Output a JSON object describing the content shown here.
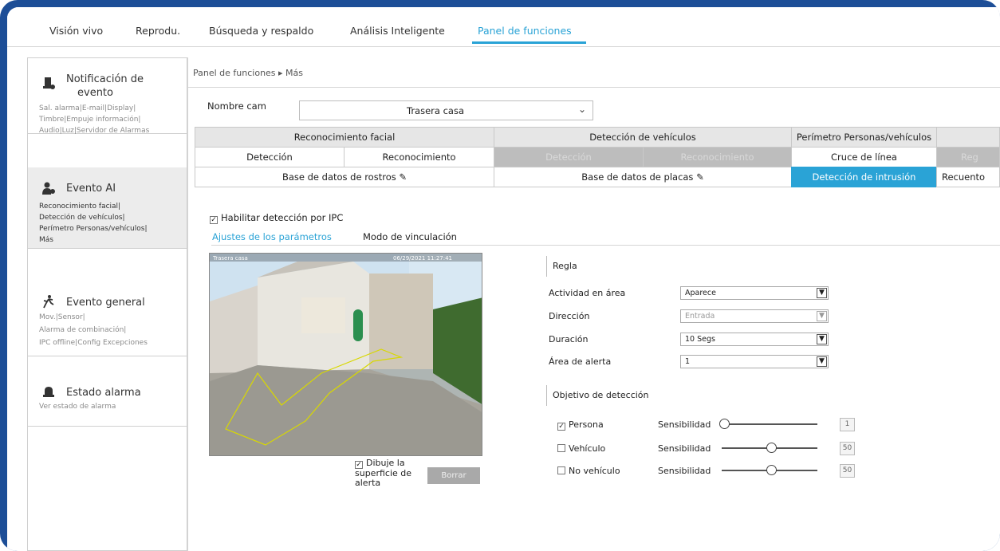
{
  "nav": {
    "tabs": [
      "Visión vivo",
      "Reprodu.",
      "Búsqueda y respaldo",
      "Análisis Inteligente",
      "Panel de funciones"
    ],
    "active_index": 4
  },
  "sidebar": {
    "groups": [
      {
        "title_line1": "Notificación de",
        "title_line2": "evento",
        "icon": "bell-icon",
        "lines": [
          "Sal. alarma|E-mail|Display|",
          "Timbre|Empuje información|",
          "Audio|Luz|Servidor de Alarmas"
        ]
      },
      {
        "title_line1": "Evento AI",
        "icon": "ai-person-icon",
        "lines": [
          "Reconocimiento facial|",
          "Detección de vehículos|",
          "Perímetro Personas/vehículos|",
          "Más"
        ]
      },
      {
        "title_line1": "Evento general",
        "icon": "motion-icon",
        "lines": [
          "Mov.|Sensor|",
          "Alarma de combinación|",
          "IPC offline|Config Excepciones"
        ]
      },
      {
        "title_line1": "Estado alarma",
        "icon": "alarm-icon",
        "lines": [
          "Ver estado de alarma"
        ]
      }
    ]
  },
  "breadcrumb": "Panel de funciones ▸ Más",
  "camera": {
    "label": "Nombre cam",
    "value": "Trasera casa"
  },
  "tabs": {
    "row1": [
      "Reconocimiento facial",
      "Detección de vehículos",
      "Perímetro Personas/vehículos"
    ],
    "row2": [
      "Detección",
      "Reconocimiento",
      "Detección",
      "Reconocimiento",
      "Cruce de línea",
      "Reg"
    ],
    "row3": [
      "Base de datos de rostros",
      "Base de datos de placas",
      "Detección de intrusión",
      "Recuento"
    ]
  },
  "enable_ipc": {
    "label": "Habilitar detección por IPC",
    "checked": true
  },
  "subtabs": [
    "Ajustes de los parámetros",
    "Modo de vinculación"
  ],
  "video": {
    "osd_left": "Trasera casa",
    "osd_right": "06/29/2021 11:27:41"
  },
  "draw": {
    "label_line1": "Dibuje la",
    "label_line2": "superficie de",
    "label_line3": "alerta",
    "checked": true,
    "button": "Borrar"
  },
  "rule": {
    "section": "Regla",
    "fields": [
      {
        "label": "Actividad en área",
        "value": "Aparece",
        "disabled": false
      },
      {
        "label": "Dirección",
        "value": "Entrada",
        "disabled": true
      },
      {
        "label": "Duración",
        "value": "10 Segs",
        "disabled": false
      },
      {
        "label": "Área de alerta",
        "value": "1",
        "disabled": false
      }
    ]
  },
  "objective": {
    "section": "Objetivo de detección",
    "sens_label": "Sensibilidad",
    "items": [
      {
        "label": "Persona",
        "checked": true,
        "value": "1",
        "level": 0.0
      },
      {
        "label": "Vehículo",
        "checked": false,
        "value": "50",
        "level": 0.5
      },
      {
        "label": "No vehículo",
        "checked": false,
        "value": "50",
        "level": 0.5
      }
    ]
  }
}
